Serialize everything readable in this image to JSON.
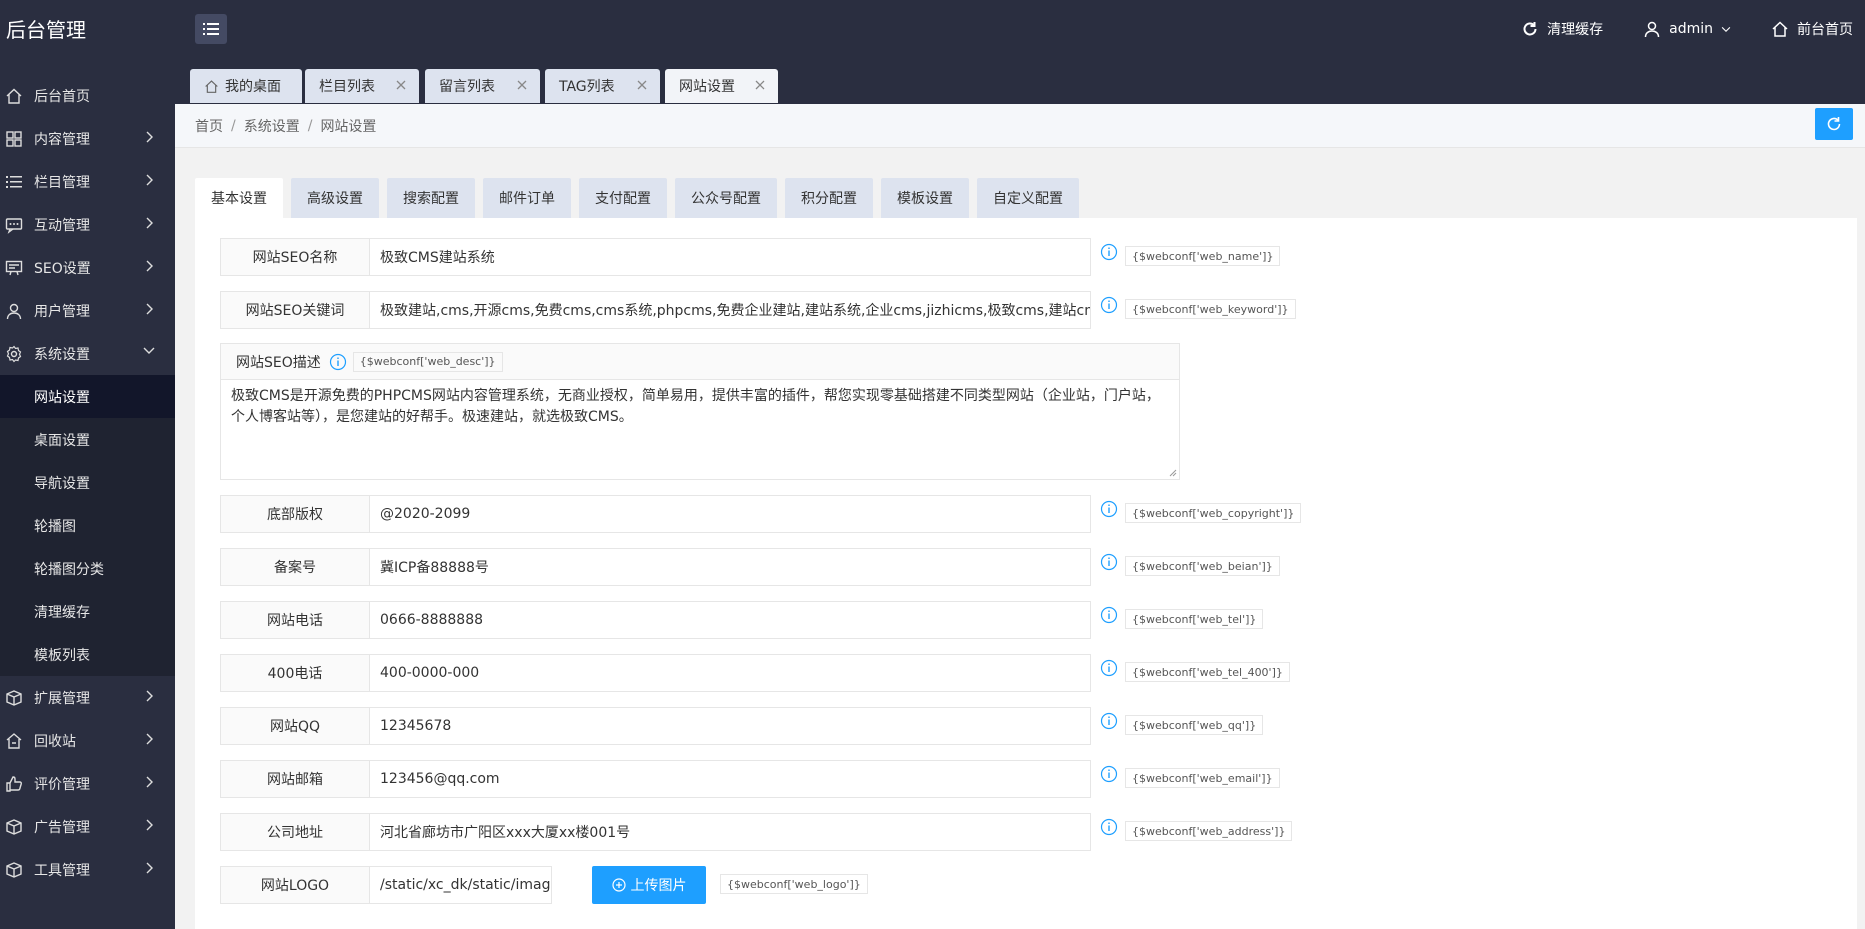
{
  "app_title": "后台管理",
  "header": {
    "clear_cache": "清理缓存",
    "user": "admin",
    "frontend": "前台首页"
  },
  "sidebar": {
    "items": [
      {
        "label": "后台首页",
        "icon": "home-icon"
      },
      {
        "label": "内容管理",
        "icon": "grid-icon"
      },
      {
        "label": "栏目管理",
        "icon": "list-icon"
      },
      {
        "label": "互动管理",
        "icon": "chat-icon"
      },
      {
        "label": "SEO设置",
        "icon": "seo-icon"
      },
      {
        "label": "用户管理",
        "icon": "user-icon"
      },
      {
        "label": "系统设置",
        "icon": "gear-icon"
      }
    ],
    "sub_items": [
      "网站设置",
      "桌面设置",
      "导航设置",
      "轮播图",
      "轮播图分类",
      "清理缓存",
      "模板列表"
    ],
    "items_after": [
      {
        "label": "扩展管理",
        "icon": "box-icon"
      },
      {
        "label": "回收站",
        "icon": "trash-icon"
      },
      {
        "label": "评价管理",
        "icon": "thumb-icon"
      },
      {
        "label": "广告管理",
        "icon": "ad-icon"
      },
      {
        "label": "工具管理",
        "icon": "tool-icon"
      }
    ]
  },
  "page_tabs": [
    "我的桌面",
    "栏目列表",
    "留言列表",
    "TAG列表",
    "网站设置"
  ],
  "breadcrumb": [
    "首页",
    "系统设置",
    "网站设置"
  ],
  "settings_tabs": [
    "基本设置",
    "高级设置",
    "搜索配置",
    "邮件订单",
    "支付配置",
    "公众号配置",
    "积分配置",
    "模板设置",
    "自定义配置"
  ],
  "fields": [
    {
      "label": "网站SEO名称",
      "value": "极致CMS建站系统",
      "tag": "{$webconf['web_name']}"
    },
    {
      "label": "网站SEO关键词",
      "value": "极致建站,cms,开源cms,免费cms,cms系统,phpcms,免费企业建站,建站系统,企业cms,jizhicms,极致cms,建站cms,建站",
      "tag": "{$webconf['web_keyword']}"
    },
    {
      "label": "底部版权",
      "value": "@2020-2099",
      "tag": "{$webconf['web_copyright']}"
    },
    {
      "label": "备案号",
      "value": "冀ICP备88888号",
      "tag": "{$webconf['web_beian']}"
    },
    {
      "label": "网站电话",
      "value": "0666-8888888",
      "tag": "{$webconf['web_tel']}"
    },
    {
      "label": "400电话",
      "value": "400-0000-000",
      "tag": "{$webconf['web_tel_400']}"
    },
    {
      "label": "网站QQ",
      "value": "12345678",
      "tag": "{$webconf['web_qq']}"
    },
    {
      "label": "网站邮箱",
      "value": "123456@qq.com",
      "tag": "{$webconf['web_email']}"
    },
    {
      "label": "公司地址",
      "value": "河北省廊坊市广阳区xxx大厦xx楼001号",
      "tag": "{$webconf['web_address']}"
    }
  ],
  "desc": {
    "label": "网站SEO描述",
    "tag": "{$webconf['web_desc']}",
    "value": "极致CMS是开源免费的PHPCMS网站内容管理系统，无商业授权，简单易用，提供丰富的插件，帮您实现零基础搭建不同类型网站（企业站，门户站，个人博客站等），是您建站的好帮手。极速建站，就选极致CMS。"
  },
  "logo_field": {
    "label": "网站LOGO",
    "value": "/static/xc_dk/static/images/l",
    "upload": "上传图片",
    "tag": "{$webconf['web_logo']}"
  },
  "colors": {
    "dark": "#2a2e40",
    "accent": "#1e9fff",
    "active_sub": "#12162a"
  }
}
